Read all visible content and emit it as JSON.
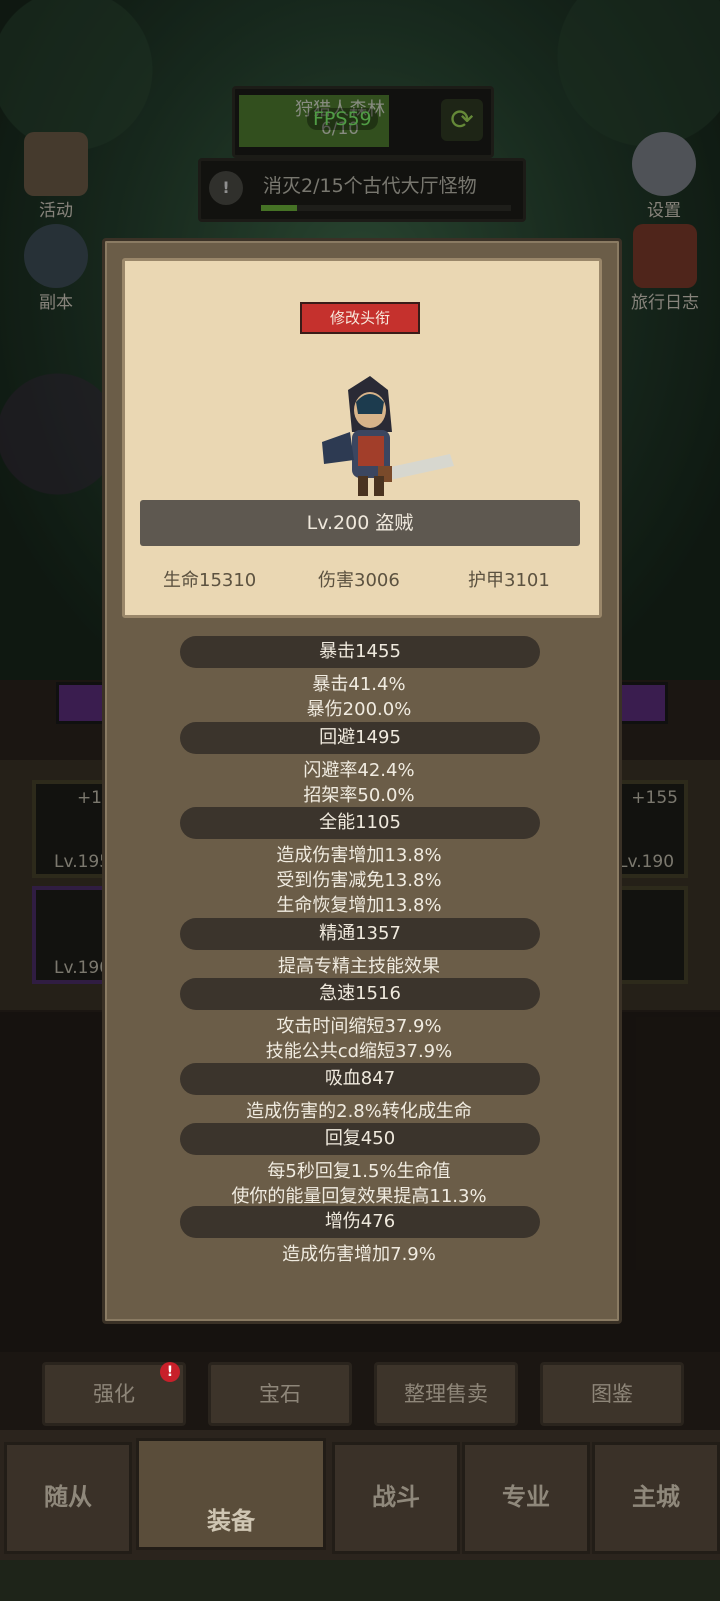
{
  "hud": {
    "stage_name": "狩猎人森林",
    "stage_progress": "6/10",
    "fps": "FPS59",
    "quest_text": "消灭2/15个古代大厅怪物"
  },
  "side": {
    "activity": "活动",
    "dungeon": "副本",
    "settings": "设置",
    "journal": "旅行日志"
  },
  "equip_slots": {
    "slot1_plus": "+1",
    "slot1_level": "Lv.195",
    "slot2_level": "Lv.190",
    "slot3_plus": "+155",
    "slot3_level": "Lv.190"
  },
  "actions": {
    "enhance": "强化",
    "gem": "宝石",
    "sort_sell": "整理售卖",
    "collection": "图鉴",
    "badge": "!"
  },
  "nav": {
    "followers": "随从",
    "equipment": "装备",
    "battle": "战斗",
    "profession": "专业",
    "main_city": "主城"
  },
  "modal": {
    "edit_title": "修改头衔",
    "level_class": "Lv.200 盗贼",
    "base_stats": {
      "hp": "生命15310",
      "damage": "伤害3006",
      "armor": "护甲3101"
    },
    "groups": [
      {
        "header": "暴击1455",
        "lines": [
          "暴击41.4%",
          "暴伤200.0%"
        ]
      },
      {
        "header": "回避1495",
        "lines": [
          "闪避率42.4%",
          "招架率50.0%"
        ]
      },
      {
        "header": "全能1105",
        "lines": [
          "造成伤害增加13.8%",
          "受到伤害减免13.8%",
          "生命恢复增加13.8%"
        ]
      },
      {
        "header": "精通1357",
        "lines": [
          "提高专精主技能效果"
        ]
      },
      {
        "header": "急速1516",
        "lines": [
          "攻击时间缩短37.9%",
          "技能公共cd缩短37.9%"
        ]
      },
      {
        "header": "吸血847",
        "lines": [
          "造成伤害的2.8%转化成生命"
        ]
      },
      {
        "header": "回复450",
        "lines": [
          "每5秒回复1.5%生命值",
          "使你的能量回复效果提高11.3%"
        ]
      },
      {
        "header": "增伤476",
        "lines": [
          "造成伤害增加7.9%"
        ]
      }
    ]
  },
  "colors": {
    "modal_bg": "#6b5d48",
    "card_bg": "#ead7b3",
    "title_btn": "#c5312d",
    "fps_text": "#7cf06a"
  }
}
